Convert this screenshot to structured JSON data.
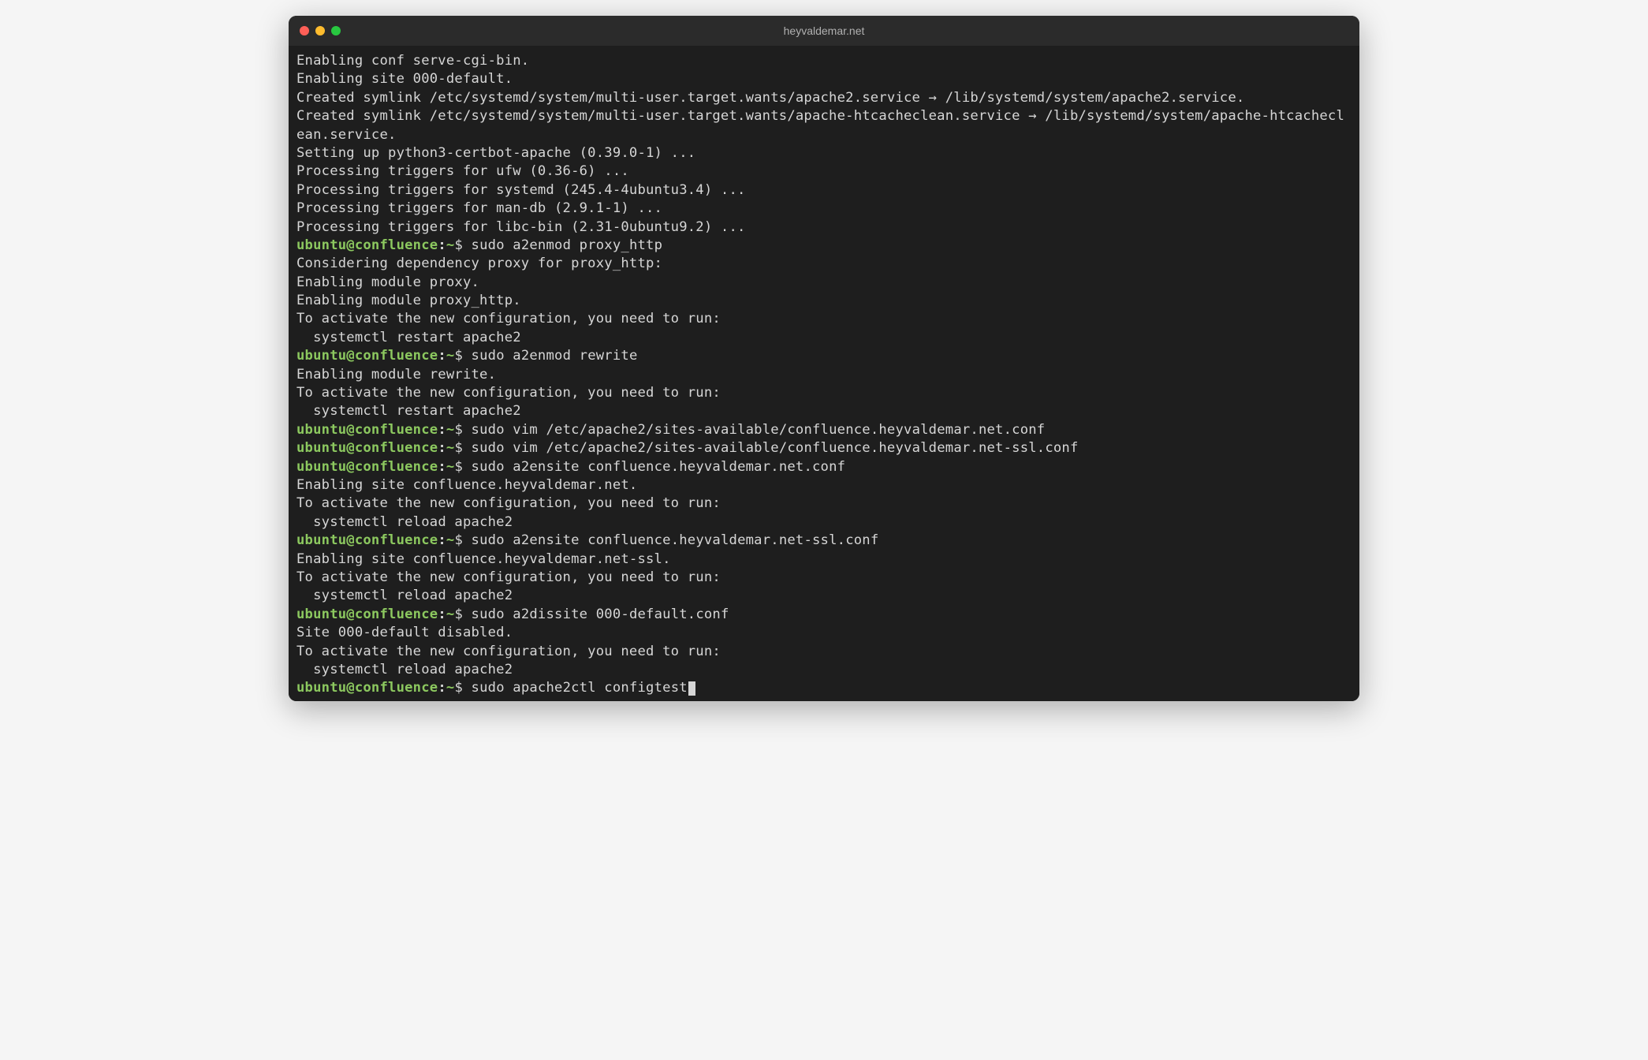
{
  "window": {
    "title": "heyvaldemar.net"
  },
  "prompt": {
    "user_host": "ubuntu@confluence",
    "colon": ":",
    "path": "~",
    "dollar": "$ "
  },
  "lines": [
    {
      "type": "out",
      "text": "Enabling conf serve-cgi-bin."
    },
    {
      "type": "out",
      "text": "Enabling site 000-default."
    },
    {
      "type": "out",
      "text": "Created symlink /etc/systemd/system/multi-user.target.wants/apache2.service → /lib/systemd/system/apache2.service."
    },
    {
      "type": "out",
      "text": "Created symlink /etc/systemd/system/multi-user.target.wants/apache-htcacheclean.service → /lib/systemd/system/apache-htcacheclean.service."
    },
    {
      "type": "out",
      "text": "Setting up python3-certbot-apache (0.39.0-1) ..."
    },
    {
      "type": "out",
      "text": "Processing triggers for ufw (0.36-6) ..."
    },
    {
      "type": "out",
      "text": "Processing triggers for systemd (245.4-4ubuntu3.4) ..."
    },
    {
      "type": "out",
      "text": "Processing triggers for man-db (2.9.1-1) ..."
    },
    {
      "type": "out",
      "text": "Processing triggers for libc-bin (2.31-0ubuntu9.2) ..."
    },
    {
      "type": "cmd",
      "text": "sudo a2enmod proxy_http"
    },
    {
      "type": "out",
      "text": "Considering dependency proxy for proxy_http:"
    },
    {
      "type": "out",
      "text": "Enabling module proxy."
    },
    {
      "type": "out",
      "text": "Enabling module proxy_http."
    },
    {
      "type": "out",
      "text": "To activate the new configuration, you need to run:"
    },
    {
      "type": "out",
      "text": "  systemctl restart apache2"
    },
    {
      "type": "cmd",
      "text": "sudo a2enmod rewrite"
    },
    {
      "type": "out",
      "text": "Enabling module rewrite."
    },
    {
      "type": "out",
      "text": "To activate the new configuration, you need to run:"
    },
    {
      "type": "out",
      "text": "  systemctl restart apache2"
    },
    {
      "type": "cmd",
      "text": "sudo vim /etc/apache2/sites-available/confluence.heyvaldemar.net.conf"
    },
    {
      "type": "cmd",
      "text": "sudo vim /etc/apache2/sites-available/confluence.heyvaldemar.net-ssl.conf"
    },
    {
      "type": "cmd",
      "text": "sudo a2ensite confluence.heyvaldemar.net.conf"
    },
    {
      "type": "out",
      "text": "Enabling site confluence.heyvaldemar.net."
    },
    {
      "type": "out",
      "text": "To activate the new configuration, you need to run:"
    },
    {
      "type": "out",
      "text": "  systemctl reload apache2"
    },
    {
      "type": "cmd",
      "text": "sudo a2ensite confluence.heyvaldemar.net-ssl.conf"
    },
    {
      "type": "out",
      "text": "Enabling site confluence.heyvaldemar.net-ssl."
    },
    {
      "type": "out",
      "text": "To activate the new configuration, you need to run:"
    },
    {
      "type": "out",
      "text": "  systemctl reload apache2"
    },
    {
      "type": "cmd",
      "text": "sudo a2dissite 000-default.conf"
    },
    {
      "type": "out",
      "text": "Site 000-default disabled."
    },
    {
      "type": "out",
      "text": "To activate the new configuration, you need to run:"
    },
    {
      "type": "out",
      "text": "  systemctl reload apache2"
    },
    {
      "type": "cmd",
      "text": "sudo apache2ctl configtest",
      "cursor": true
    }
  ]
}
